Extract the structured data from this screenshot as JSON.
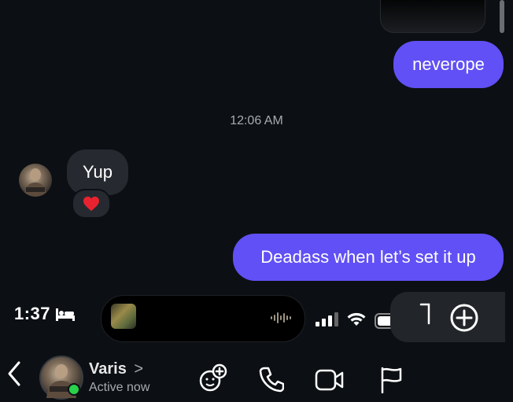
{
  "messages": {
    "outgoing_1": "neverope",
    "timestamp": "12:06 AM",
    "incoming_1": "Yup",
    "reaction": "❤️",
    "outgoing_2": "Deadass when let’s set it up"
  },
  "status_bar": {
    "time": "1:37",
    "sleep_icon": "bed-icon",
    "signal_icon": "cellular-signal-icon",
    "wifi_icon": "wifi-icon",
    "battery_icon": "battery-icon"
  },
  "contact": {
    "name": "Varis",
    "status": "Active now",
    "chevron": ">"
  },
  "icons": {
    "back": "chevron-left-icon",
    "effects": "effects-icon",
    "call": "phone-icon",
    "video": "video-camera-icon",
    "report": "flag-icon",
    "add": "plus-circle-icon",
    "waveform": "waveform-icon"
  },
  "colors": {
    "background": "#0c1014",
    "outgoing_bubble": "#6150f5",
    "incoming_bubble": "#262a30",
    "timestamp": "#a7aaae",
    "online": "#2ad14b"
  }
}
